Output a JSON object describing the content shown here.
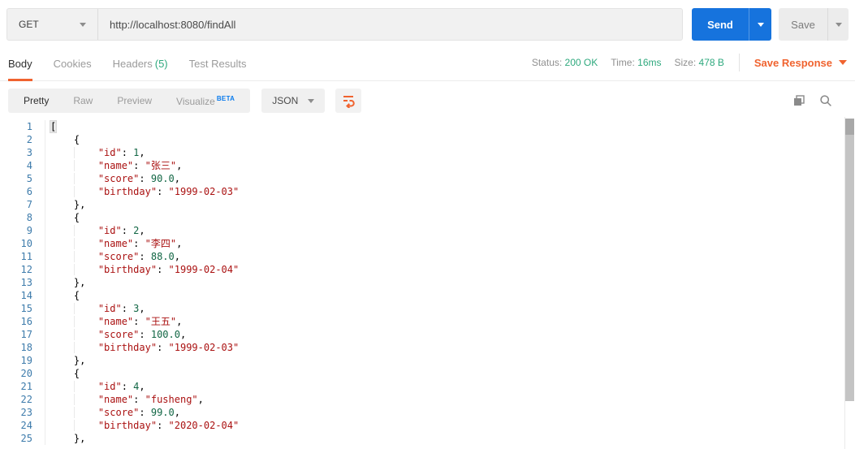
{
  "request": {
    "method": "GET",
    "url": "http://localhost:8080/findAll",
    "send_label": "Send",
    "save_label": "Save"
  },
  "response_tabs": {
    "tabs": [
      {
        "label": "Body",
        "active": true
      },
      {
        "label": "Cookies",
        "active": false
      },
      {
        "label": "Headers",
        "count": "(5)",
        "active": false
      },
      {
        "label": "Test Results",
        "active": false
      }
    ],
    "meta": [
      {
        "label": "Status:",
        "value": "200 OK"
      },
      {
        "label": "Time:",
        "value": "16ms"
      },
      {
        "label": "Size:",
        "value": "478 B"
      }
    ],
    "save_response_label": "Save Response"
  },
  "view_bar": {
    "modes": [
      {
        "label": "Pretty",
        "active": true
      },
      {
        "label": "Raw",
        "active": false
      },
      {
        "label": "Preview",
        "active": false
      },
      {
        "label": "Visualize",
        "active": false,
        "badge": "BETA"
      }
    ],
    "language": "JSON"
  },
  "icons": {
    "method_chevron": "chevron-down-icon",
    "send_chevron": "chevron-down-icon",
    "save_chevron": "chevron-down-icon",
    "save_response_chevron": "chevron-down-icon",
    "json_chevron": "chevron-down-icon",
    "format": "wrap-format-icon",
    "copy": "copy-icon",
    "search": "search-icon"
  },
  "colors": {
    "accent_orange": "#F0632F",
    "send_blue": "#1673DD",
    "status_green": "#2FA97E",
    "beta_blue": "#097BED",
    "json_key": "#AA1111",
    "json_string": "#AA1111",
    "json_number": "#116644",
    "line_number_blue": "#3D7BAB"
  },
  "response_body": {
    "lines": [
      "[",
      "    {",
      "        \"id\": 1,",
      "        \"name\": \"张三\",",
      "        \"score\": 90.0,",
      "        \"birthday\": \"1999-02-03\"",
      "    },",
      "    {",
      "        \"id\": 2,",
      "        \"name\": \"李四\",",
      "        \"score\": 88.0,",
      "        \"birthday\": \"1999-02-04\"",
      "    },",
      "    {",
      "        \"id\": 3,",
      "        \"name\": \"王五\",",
      "        \"score\": 100.0,",
      "        \"birthday\": \"1999-02-03\"",
      "    },",
      "    {",
      "        \"id\": 4,",
      "        \"name\": \"fusheng\",",
      "        \"score\": 99.0,",
      "        \"birthday\": \"2020-02-04\"",
      "    },"
    ]
  }
}
